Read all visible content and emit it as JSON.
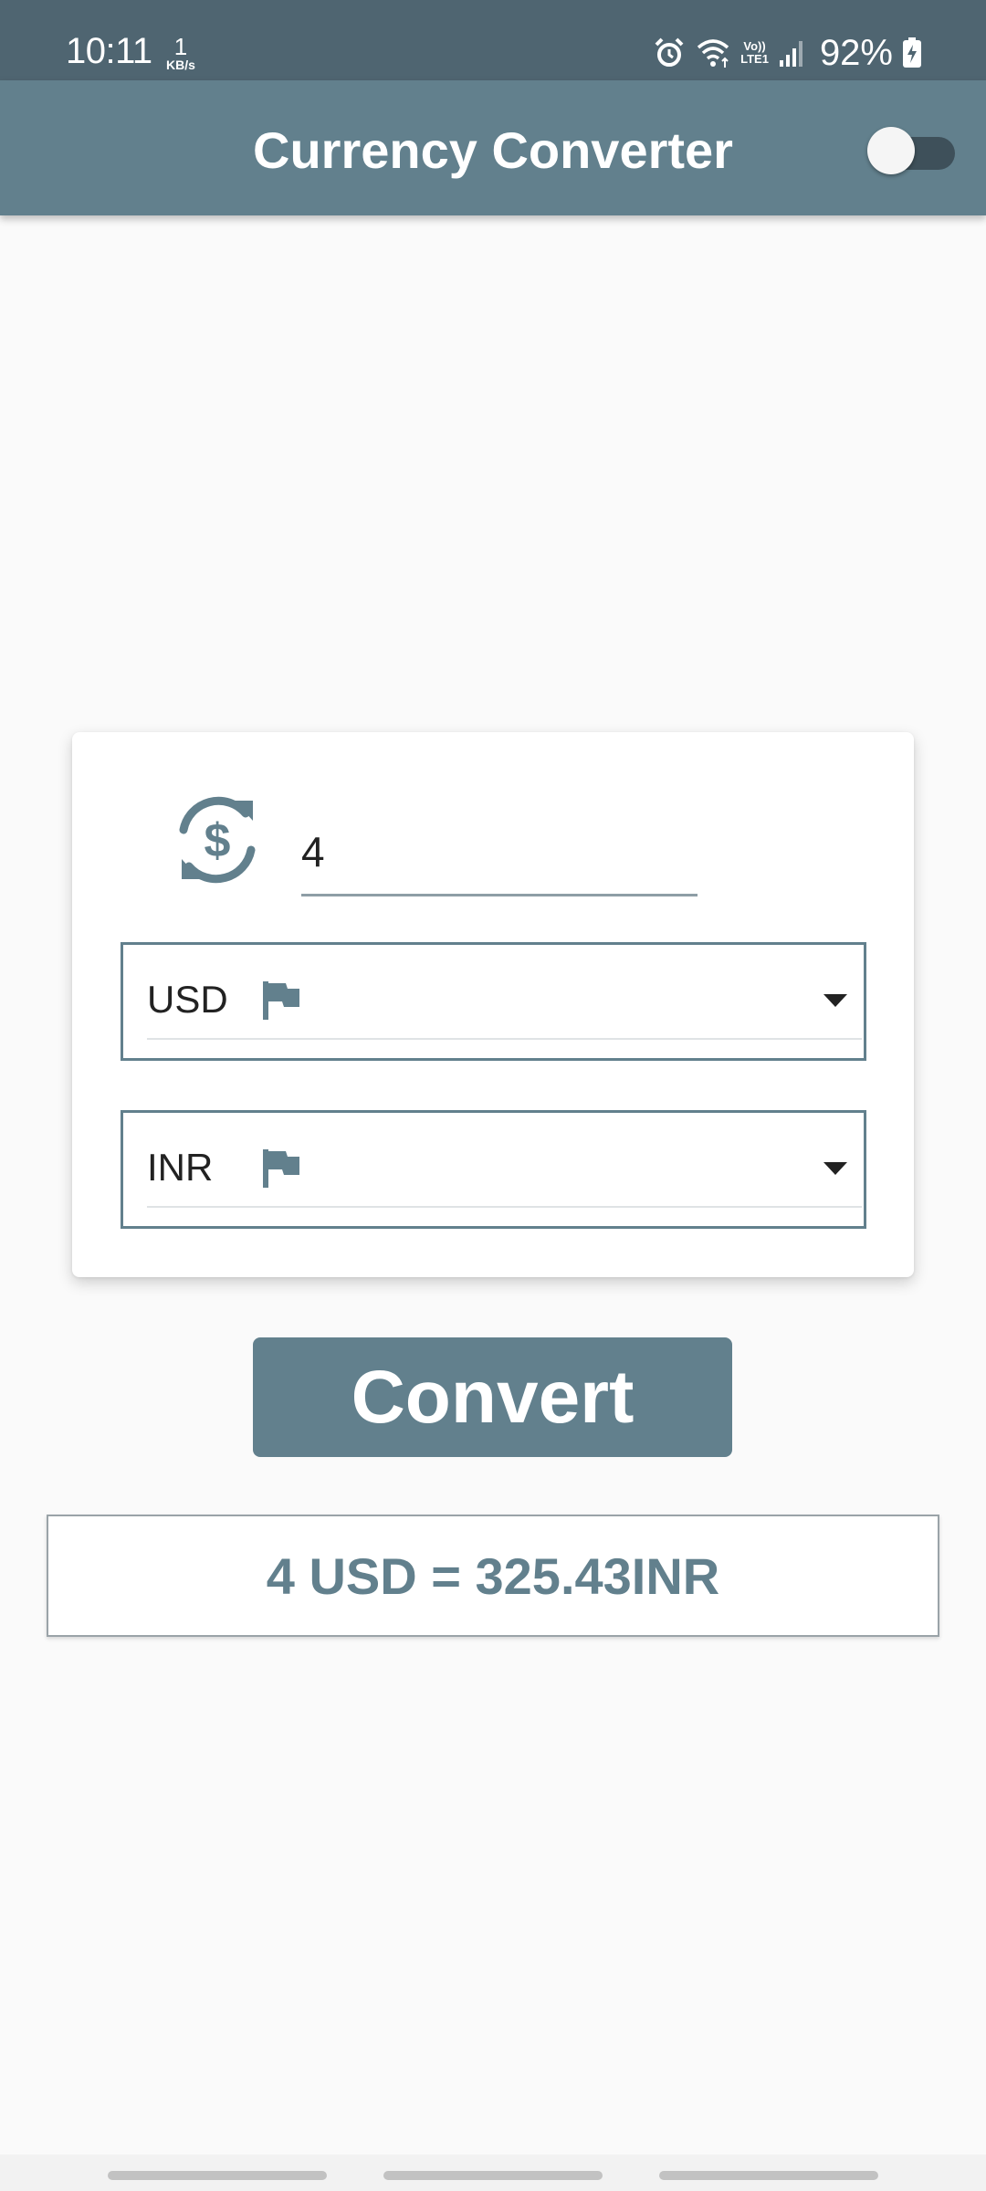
{
  "status_bar": {
    "time": "10:11",
    "net_speed_value": "1",
    "net_speed_unit": "KB/s",
    "volte_top": "Vo))",
    "volte_bottom": "LTE1",
    "battery": "92%",
    "icons": [
      "alarm-icon",
      "wifi-icon",
      "volte-icon",
      "signal-icon",
      "battery-icon"
    ]
  },
  "app_bar": {
    "title": "Currency Converter",
    "theme_toggle_on": false
  },
  "converter": {
    "amount_value": "4",
    "from_currency": "USD",
    "to_currency": "INR",
    "convert_label": "Convert",
    "result": "4 USD = 325.43INR"
  },
  "colors": {
    "status_bar": "#4f6571",
    "primary": "#62808d",
    "background": "#fafafa"
  }
}
